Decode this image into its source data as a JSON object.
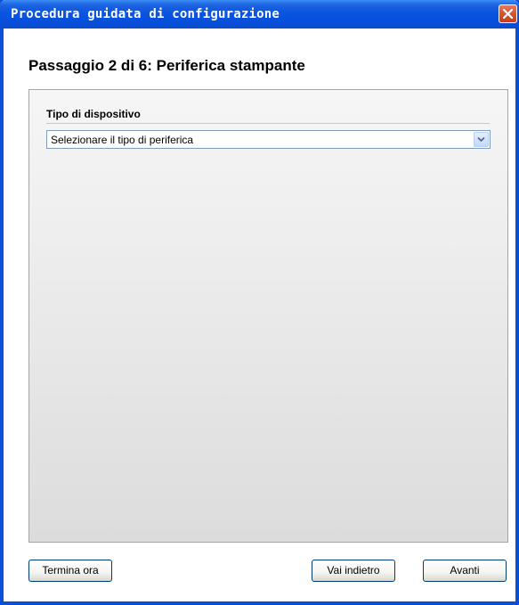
{
  "window": {
    "title": "Procedura guidata di configurazione"
  },
  "wizard": {
    "step_heading": "Passaggio 2 di 6: Periferica stampante"
  },
  "device_type": {
    "label": "Tipo di dispositivo",
    "selected_value": "Selezionare il tipo di periferica"
  },
  "buttons": {
    "finish_now": "Termina ora",
    "go_back": "Vai indietro",
    "next": "Avanti"
  },
  "icons": {
    "close": "close-icon",
    "dropdown": "chevron-down-icon"
  },
  "colors": {
    "titlebar": "#0a4fd6",
    "close_button": "#d9522c",
    "window_border": "#0a4fd6"
  }
}
